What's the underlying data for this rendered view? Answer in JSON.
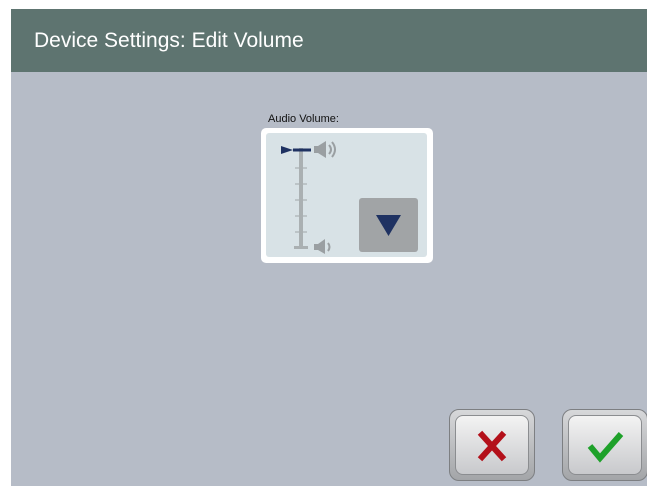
{
  "header": {
    "title": "Device Settings: Edit Volume"
  },
  "volume": {
    "label": "Audio Volume:",
    "level": 1.0,
    "icons": {
      "max": "speaker-loud-icon",
      "min": "speaker-quiet-icon",
      "indicator": "arrow-right-icon"
    },
    "down_icon": "triangle-down-icon"
  },
  "actions": {
    "cancel_icon": "x-icon",
    "confirm_icon": "checkmark-icon"
  },
  "colors": {
    "header": "#5e7470",
    "background": "#b6bcc7",
    "cancel": "#b3101a",
    "confirm": "#1ea12a"
  }
}
